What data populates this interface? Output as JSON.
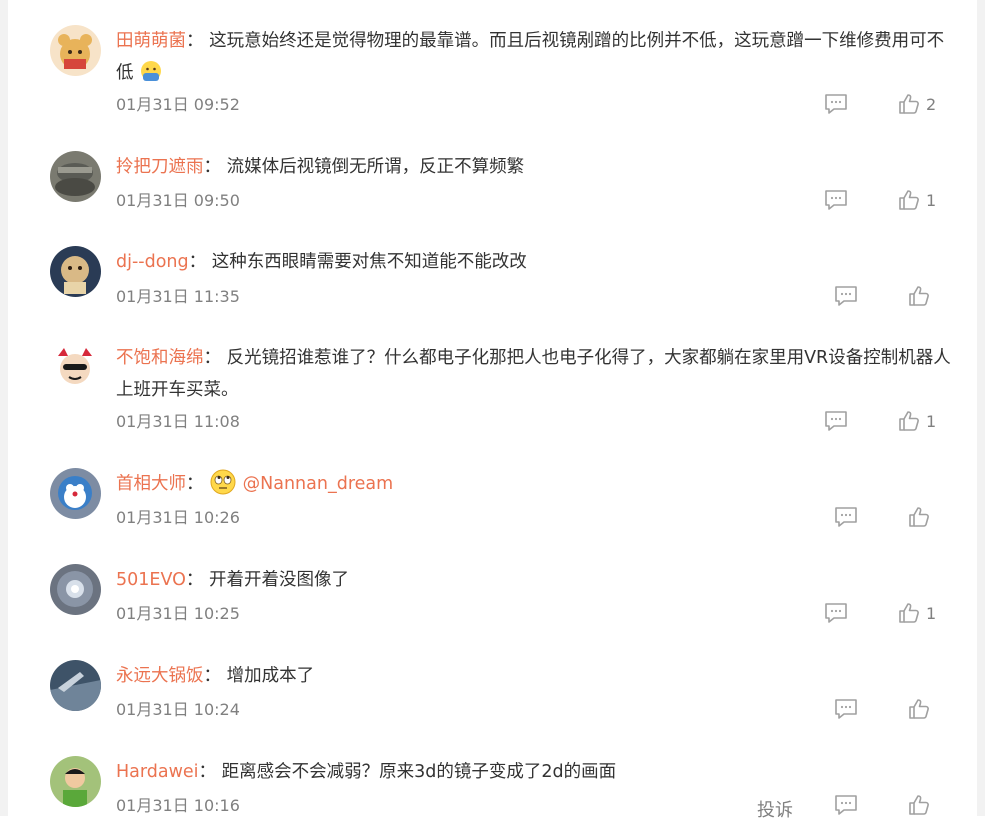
{
  "comments": [
    {
      "username": "田萌萌菌",
      "separator": "：",
      "text": "这玩意始终还是觉得物理的最靠谱。而且后视镜剐蹭的比例并不低，这玩意蹭一下维修费用可不低",
      "emoji": "sad-face-emoji",
      "time": "01月31日 09:52",
      "likes": "2",
      "avatar_color": "#f7e3c8"
    },
    {
      "username": "拎把刀遮雨",
      "separator": "：",
      "text": "流媒体后视镜倒无所谓，反正不算频繁",
      "time": "01月31日 09:50",
      "likes": "1",
      "avatar_color": "#7a7a70"
    },
    {
      "username": "dj--dong",
      "separator": "：",
      "text": "这种东西眼睛需要对焦不知道能不能改改",
      "time": "01月31日 11:35",
      "likes": "",
      "avatar_color": "#2a3b55"
    },
    {
      "username": "不饱和海绵",
      "separator": "：",
      "text": "反光镜招谁惹谁了？什么都电子化那把人也电子化得了，大家都躺在家里用VR设备控制机器人上班开车买菜。",
      "time": "01月31日 11:08",
      "likes": "1",
      "avatar_color": "#ffffff"
    },
    {
      "username": "首相大师",
      "separator": "：",
      "emoji": "eye-roll-emoji",
      "mention": "@Nannan_dream",
      "time": "01月31日 10:26",
      "likes": "",
      "avatar_color": "#7d8ca3"
    },
    {
      "username": "501EVO",
      "separator": "：",
      "text": "开着开着没图像了",
      "time": "01月31日 10:25",
      "likes": "1",
      "avatar_color": "#6b7380"
    },
    {
      "username": "永远大锅饭",
      "separator": "：",
      "text": "增加成本了",
      "time": "01月31日 10:24",
      "likes": "",
      "avatar_color": "#3e5368"
    },
    {
      "username": "Hardawei",
      "separator": "：",
      "text": "距离感会不会减弱？原来3d的镜子变成了2d的画面",
      "time": "01月31日 10:16",
      "likes": "",
      "report": "投诉",
      "avatar_color": "#a3c27a"
    }
  ],
  "colors": {
    "username": "#eb7350",
    "text": "#333333",
    "meta": "#808080",
    "icon": "#a0a0a0"
  }
}
